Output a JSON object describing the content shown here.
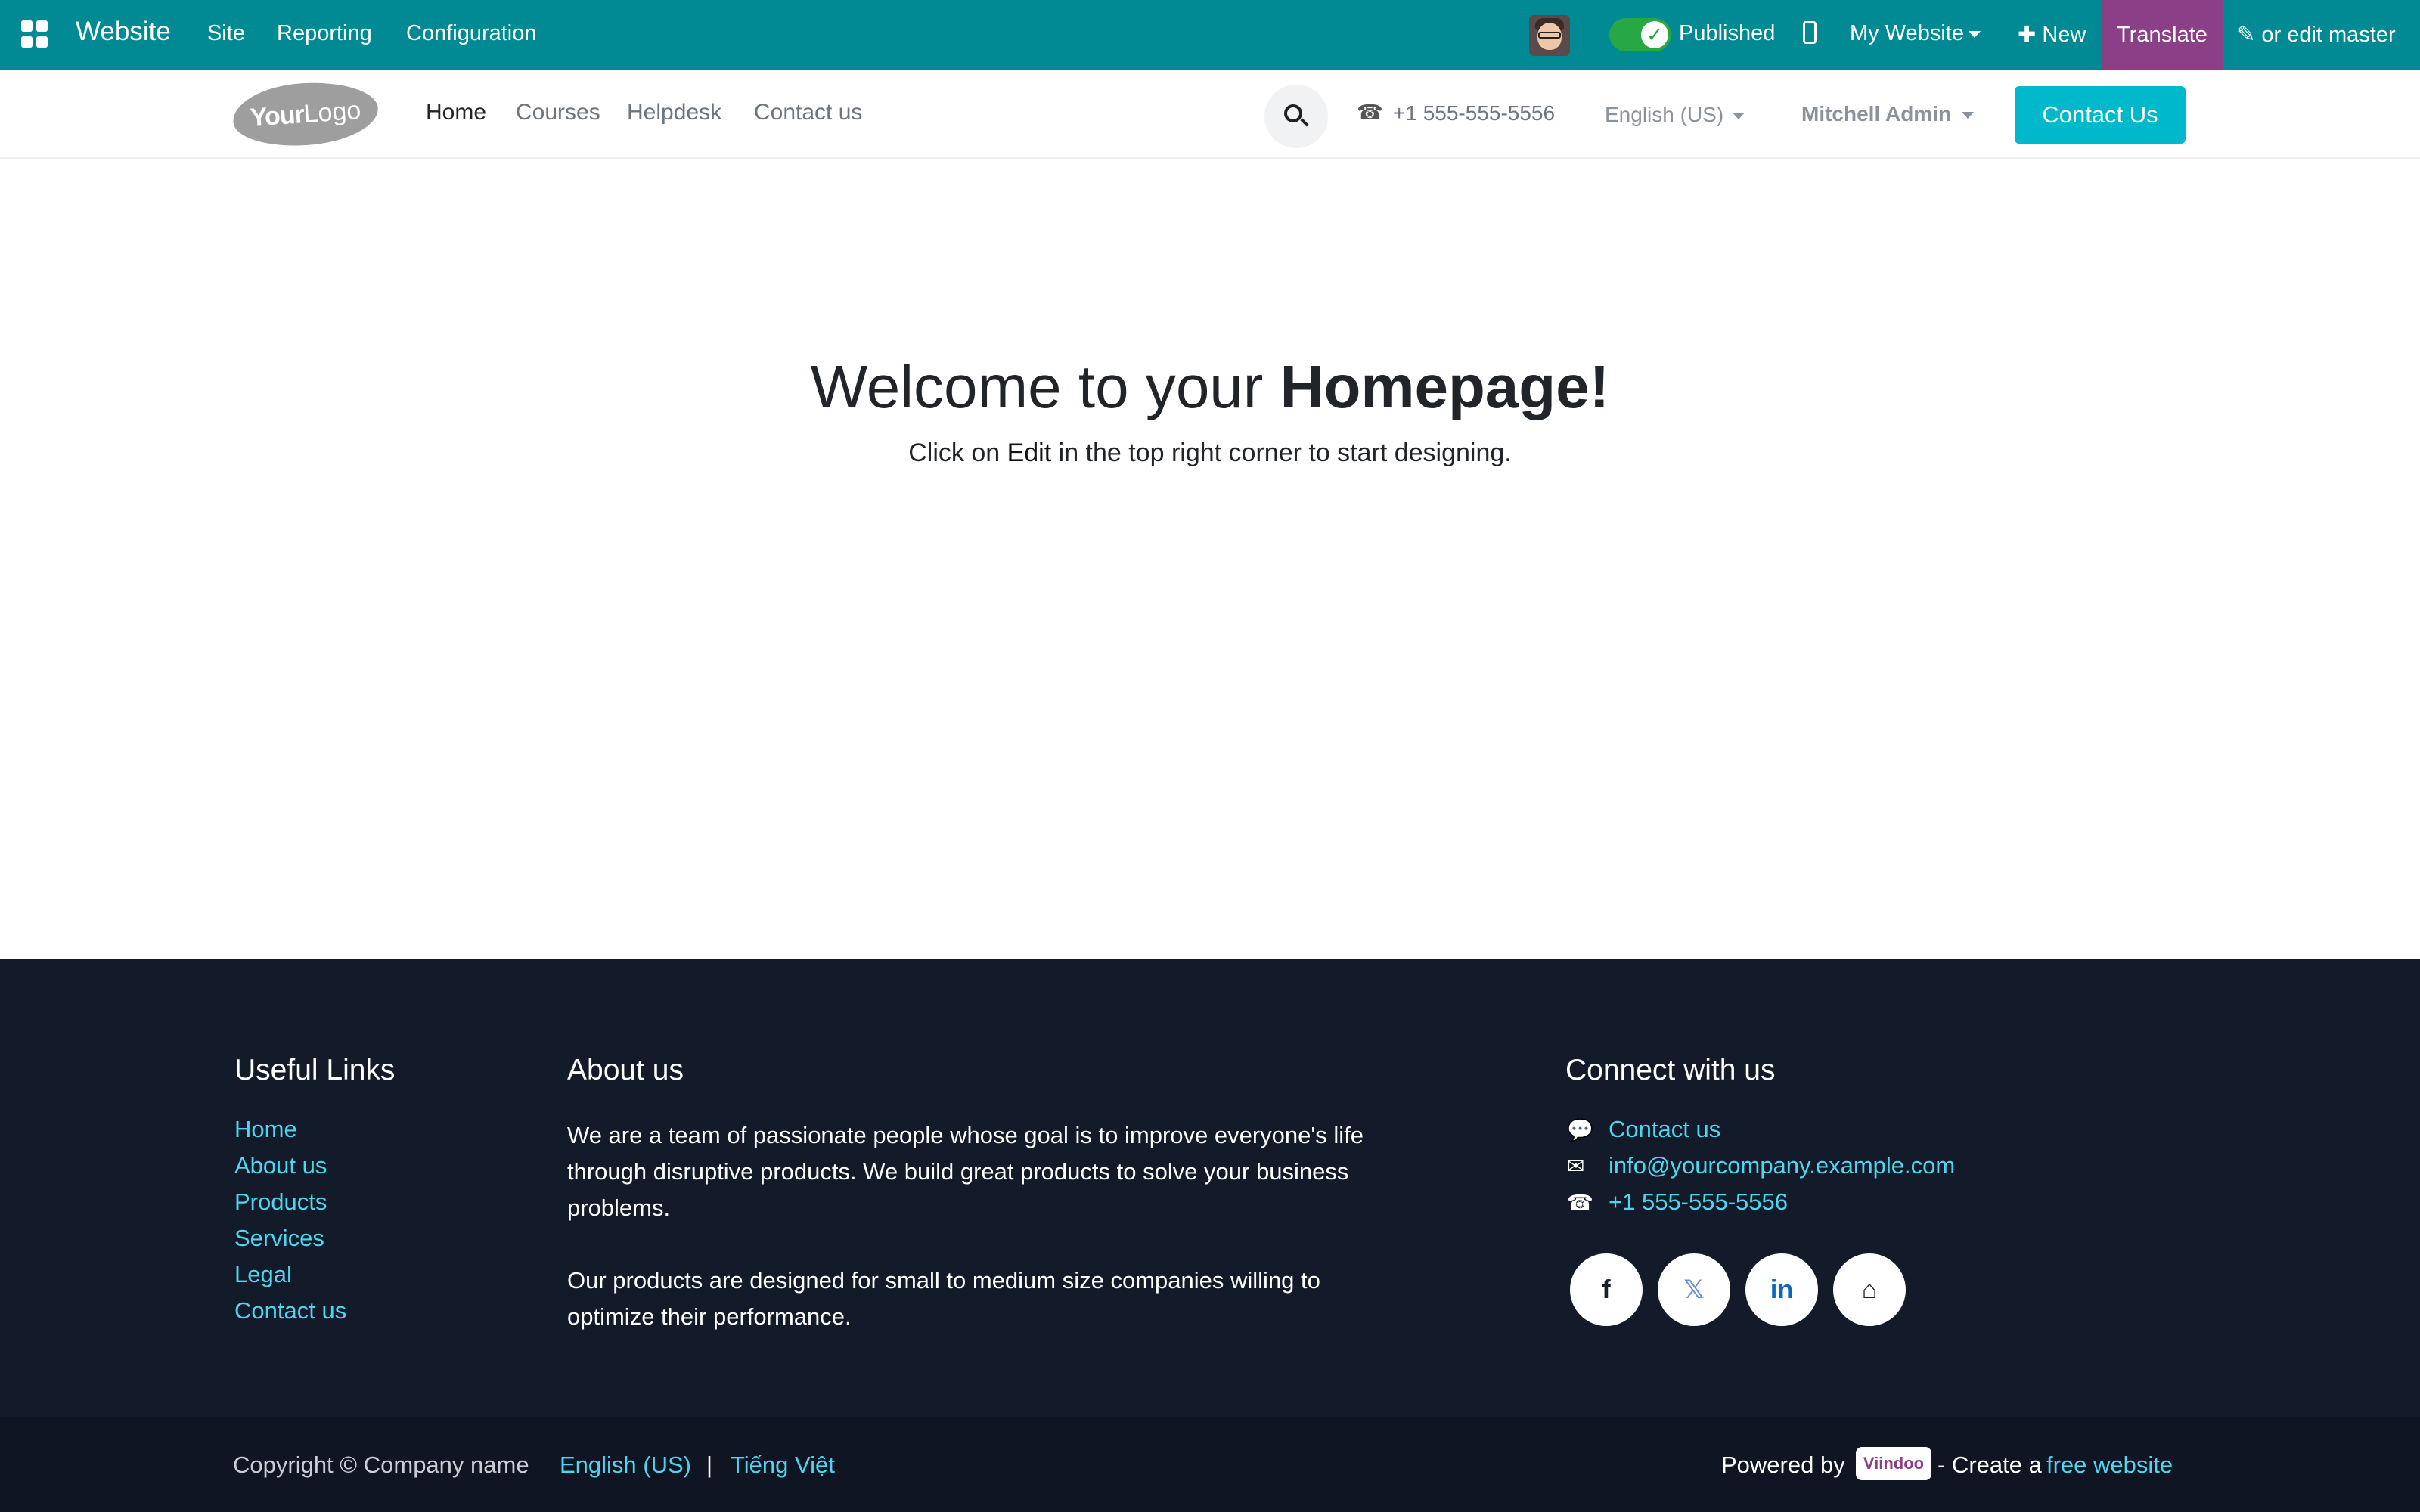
{
  "adminbar": {
    "brand": "Website",
    "menu": [
      "Site",
      "Reporting",
      "Configuration"
    ],
    "published_label": "Published",
    "my_website": "My Website",
    "new_label": "New",
    "translate_label": "Translate",
    "edit_master_label": "or edit master",
    "color": "#018a93"
  },
  "header": {
    "logo_your": "Your",
    "logo_logo": "Logo",
    "nav": [
      "Home",
      "Courses",
      "Helpdesk",
      "Contact us"
    ],
    "phone": "+1 555-555-5556",
    "language": "English (US)",
    "user": "Mitchell Admin",
    "cta": "Contact Us"
  },
  "hero": {
    "title_pre": "Welcome to your ",
    "title_bold": "Homepage!",
    "sub_pre": "Click on ",
    "sub_bold": "Edit",
    "sub_post": " in the top right corner to start designing."
  },
  "footer": {
    "useful_links_title": "Useful Links",
    "useful_links": [
      "Home",
      "About us",
      "Products",
      "Services",
      "Legal",
      "Contact us"
    ],
    "about_title": "About us",
    "about_p1": "We are a team of passionate people whose goal is to improve everyone's life through disruptive products. We build great products to solve your business problems.",
    "about_p2": "Our products are designed for small to medium size companies willing to optimize their performance.",
    "connect_title": "Connect with us",
    "contact_link": "Contact us",
    "email": "info@yourcompany.example.com",
    "phone": "+1 555-555-5556",
    "social": [
      "facebook-icon",
      "x-twitter-icon",
      "linkedin-icon",
      "home-icon"
    ]
  },
  "bottom": {
    "copyright": "Copyright © Company name",
    "lang_en": "English (US)",
    "lang_vi": "Tiếng Việt",
    "powered_by": "Powered by",
    "viindoo": "Viindoo",
    "create_a": "- Create a",
    "free_website": "free website"
  }
}
